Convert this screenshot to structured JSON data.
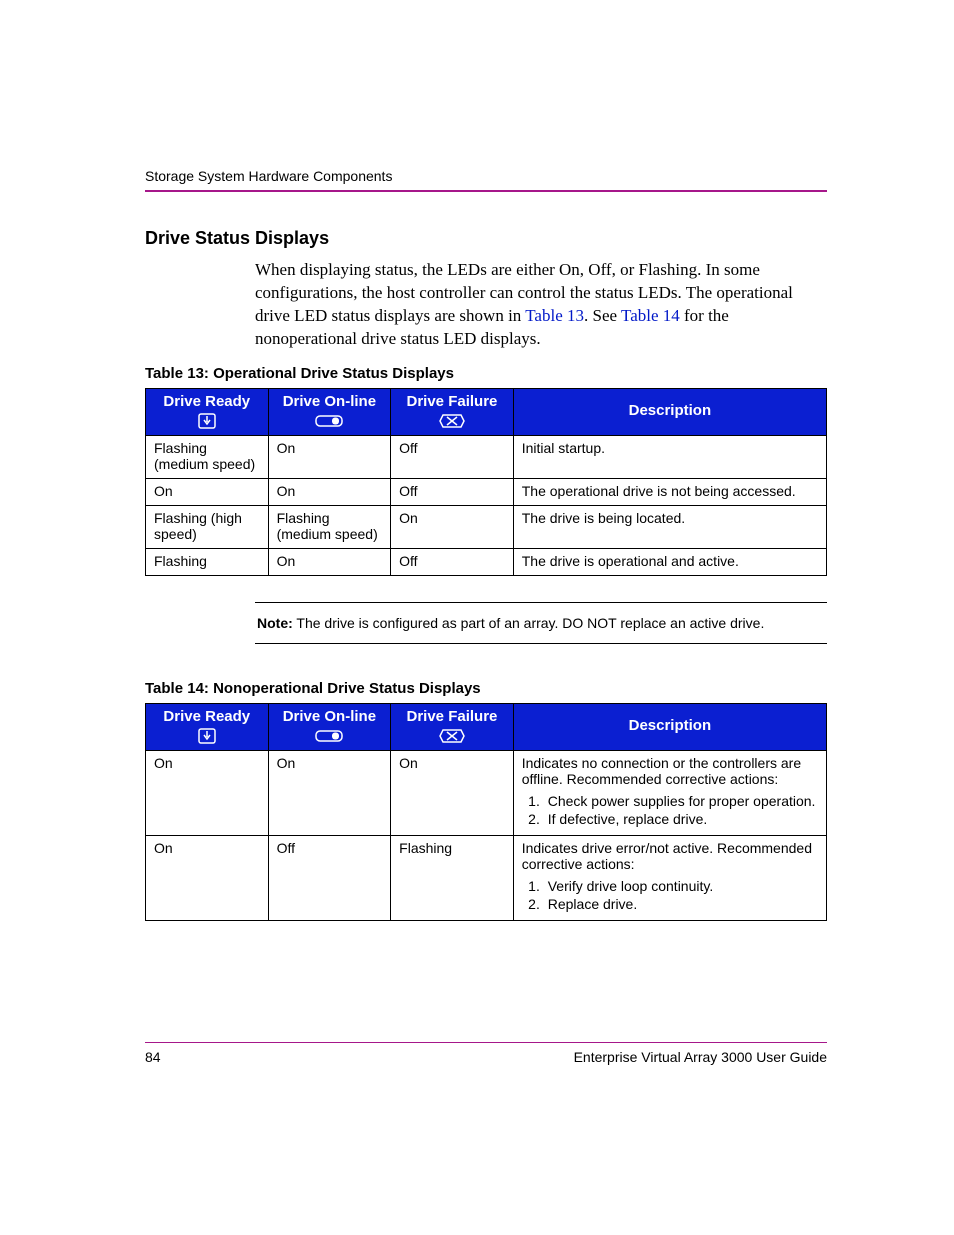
{
  "running_head": "Storage System Hardware Components",
  "section_heading": "Drive Status Displays",
  "intro_before_link1": "When displaying status, the LEDs are either On, Off, or Flashing. In some configurations, the host controller can control the status LEDs. The operational drive LED status displays are shown in ",
  "link1": "Table 13",
  "intro_mid": ". See ",
  "link2": "Table 14",
  "intro_after_link2": " for the nonoperational drive status LED displays.",
  "table13": {
    "caption": "Table 13:  Operational Drive Status Displays",
    "headers": {
      "col1": "Drive Ready",
      "col2": "Drive On-line",
      "col3": "Drive Failure",
      "col4": "Description"
    },
    "rows": [
      {
        "c1": "Flashing (medium speed)",
        "c2": "On",
        "c3": "Off",
        "c4": "Initial startup."
      },
      {
        "c1": "On",
        "c2": "On",
        "c3": "Off",
        "c4": "The operational drive is not being accessed."
      },
      {
        "c1": "Flashing (high speed)",
        "c2": "Flashing (medium speed)",
        "c3": "On",
        "c4": "The drive is being located."
      },
      {
        "c1": "Flashing",
        "c2": "On",
        "c3": "Off",
        "c4": "The drive is operational and active."
      }
    ]
  },
  "note_label": "Note:",
  "note_text": "  The drive is configured as part of an array. DO NOT replace an active drive.",
  "table14": {
    "caption": "Table 14:  Nonoperational Drive Status Displays",
    "headers": {
      "col1": "Drive Ready",
      "col2": "Drive On-line",
      "col3": "Drive Failure",
      "col4": "Description"
    },
    "rows": [
      {
        "c1": "On",
        "c2": "On",
        "c3": "On",
        "desc_text": "Indicates no connection or the controllers are offline. Recommended corrective actions:",
        "items": [
          "Check power supplies for proper operation.",
          "If defective, replace drive."
        ]
      },
      {
        "c1": "On",
        "c2": "Off",
        "c3": "Flashing",
        "desc_text": "Indicates drive error/not active. Recommended corrective actions:",
        "items": [
          "Verify drive loop continuity.",
          "Replace drive."
        ]
      }
    ]
  },
  "footer": {
    "page_number": "84",
    "doc_title": "Enterprise Virtual Array 3000 User Guide"
  }
}
